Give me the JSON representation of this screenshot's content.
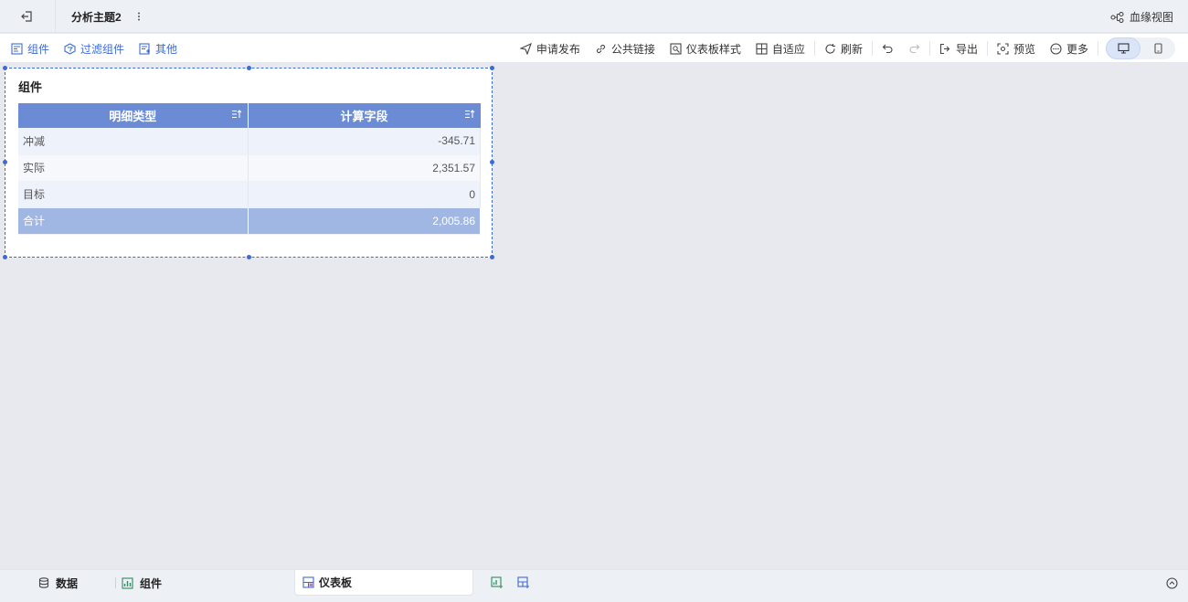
{
  "topbar": {
    "tab_title": "分析主题2",
    "lineage_label": "血缘视图"
  },
  "toolbar": {
    "left": [
      {
        "label": "组件",
        "icon": "component-icon"
      },
      {
        "label": "过滤组件",
        "icon": "filter-component-icon"
      },
      {
        "label": "其他",
        "icon": "other-icon"
      }
    ],
    "right": {
      "publish": "申请发布",
      "public_link": "公共链接",
      "dashboard_style": "仪表板样式",
      "auto_fit": "自适应",
      "refresh": "刷新",
      "export": "导出",
      "preview": "预览",
      "more": "更多"
    }
  },
  "widget": {
    "title": "组件",
    "table": {
      "columns": [
        "明细类型",
        "计算字段"
      ],
      "rows": [
        {
          "type": "冲减",
          "value": "-345.71"
        },
        {
          "type": "实际",
          "value": "2,351.57"
        },
        {
          "type": "目标",
          "value": "0"
        }
      ],
      "total": {
        "type": "合计",
        "value": "2,005.86"
      }
    }
  },
  "bottombar": {
    "data_label": "数据",
    "component_label": "组件",
    "dashboard_label": "仪表板"
  },
  "colors": {
    "accent": "#3d6bd4",
    "header": "#6b8cd5",
    "total_row": "#a1b7e3"
  }
}
